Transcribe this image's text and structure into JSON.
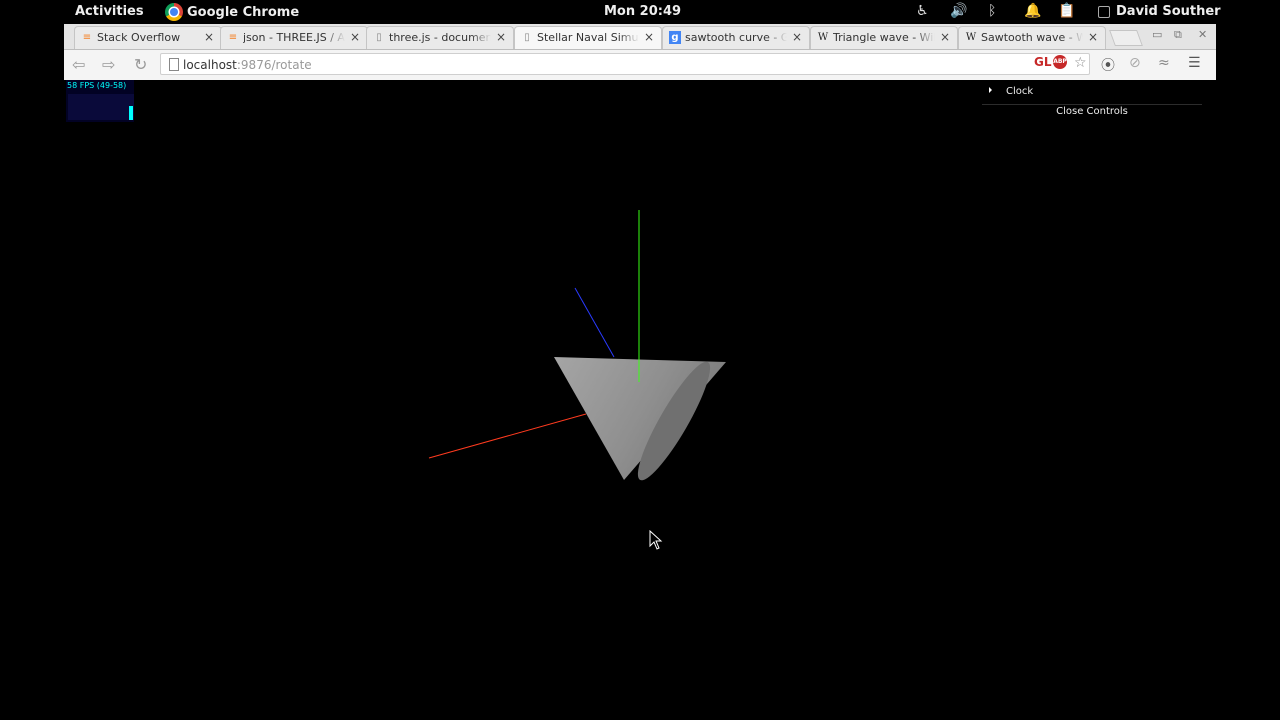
{
  "system_bar": {
    "activities": "Activities",
    "app_name": "Google Chrome",
    "clock": "Mon 20:49",
    "user": "David Souther",
    "tray_icons": [
      "accessibility-icon",
      "volume-icon",
      "bluetooth-icon",
      "notification-icon",
      "clipboard-icon"
    ]
  },
  "browser": {
    "tabs": [
      {
        "title": "Stack Overflow",
        "favicon": "stackoverflow-icon"
      },
      {
        "title": "json - THREE.JS / Ani",
        "favicon": "stackoverflow-icon"
      },
      {
        "title": "three.js - documenta",
        "favicon": "page-icon"
      },
      {
        "title": "Stellar Naval Simulat",
        "favicon": "page-icon",
        "active": true
      },
      {
        "title": "sawtooth curve - Go",
        "favicon": "google-icon"
      },
      {
        "title": "Triangle wave - Wiki",
        "favicon": "wikipedia-icon"
      },
      {
        "title": "Sawtooth wave - Wi",
        "favicon": "wikipedia-icon"
      }
    ],
    "url_host": "localhost",
    "url_path": ":9876/rotate",
    "extensions": {
      "gl": "GL",
      "abp": "ABP"
    }
  },
  "page": {
    "fps_label": "58 FPS (49-58)",
    "gui_folder": "Clock",
    "gui_close": "Close Controls"
  },
  "colors": {
    "x_axis": "#ff3b1f",
    "y_axis": "#39ff14",
    "z_axis": "#2a3bff",
    "cone": "#9a9a9a"
  }
}
